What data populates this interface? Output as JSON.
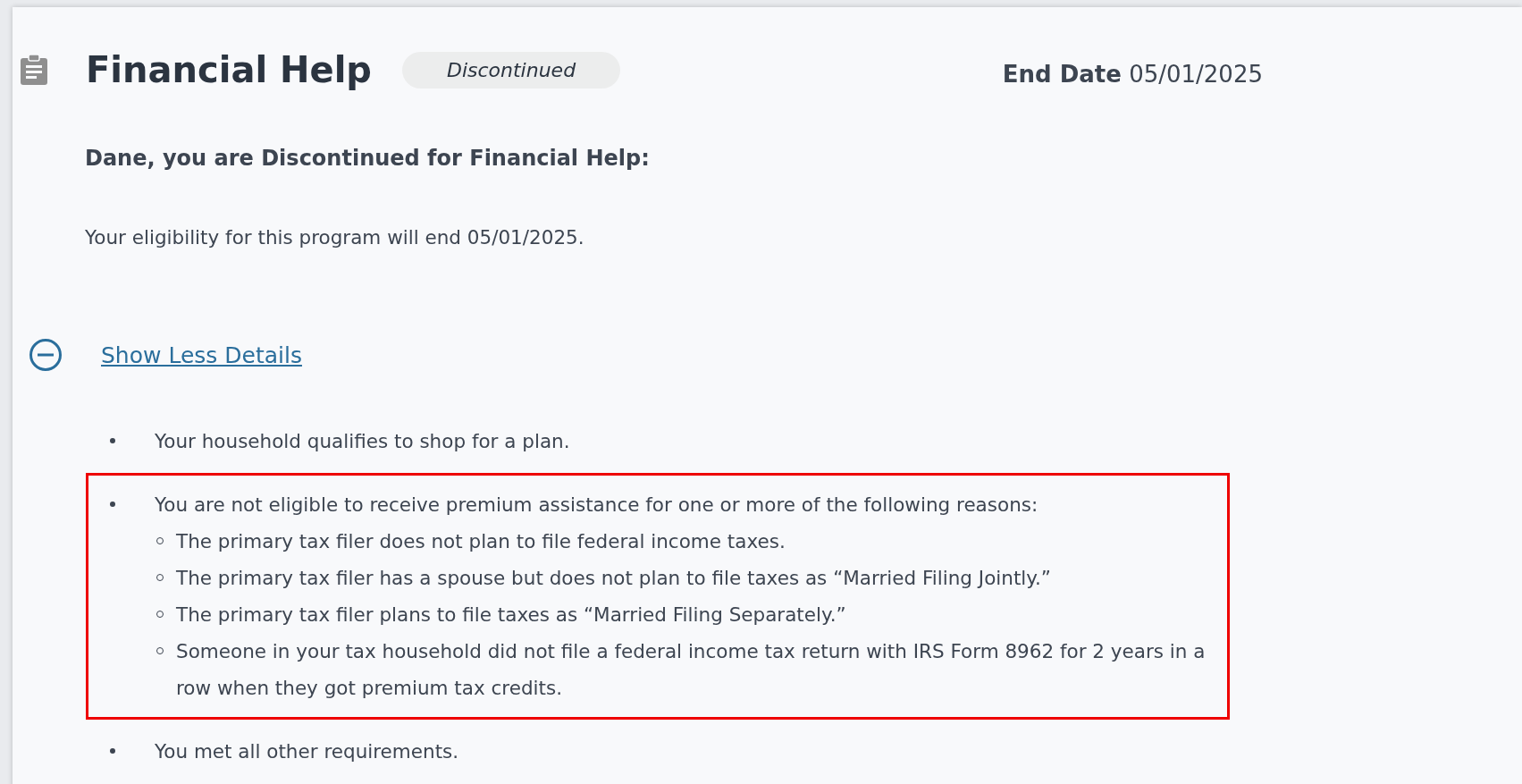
{
  "header": {
    "title": "Financial Help",
    "status_badge": "Discontinued",
    "end_date_label": "End Date",
    "end_date": "05/01/2025"
  },
  "greeting": "Dane, you are Discontinued for Financial Help:",
  "eligibility_text": "Your eligibility for this program will end 05/01/2025.",
  "details_toggle": {
    "label": "Show Less Details",
    "expanded": true
  },
  "details": [
    {
      "text": "Your household qualifies to shop for a plan.",
      "highlighted": false
    },
    {
      "text": "You are not eligible to receive premium assistance for one or more of the following reasons:",
      "highlighted": true,
      "children": [
        {
          "text": "The primary tax filer does not plan to file federal income taxes."
        },
        {
          "text": "The primary tax filer has a spouse but does not plan to file taxes as “Married Filing Jointly.”"
        },
        {
          "text": "The primary tax filer plans to file taxes as “Married Filing Separately.”"
        },
        {
          "text": "Someone in your tax household did not file a federal income tax return with IRS Form 8962 for 2 years in a row when they got premium tax credits."
        }
      ]
    },
    {
      "text": "You met all other requirements.",
      "highlighted": false
    }
  ]
}
